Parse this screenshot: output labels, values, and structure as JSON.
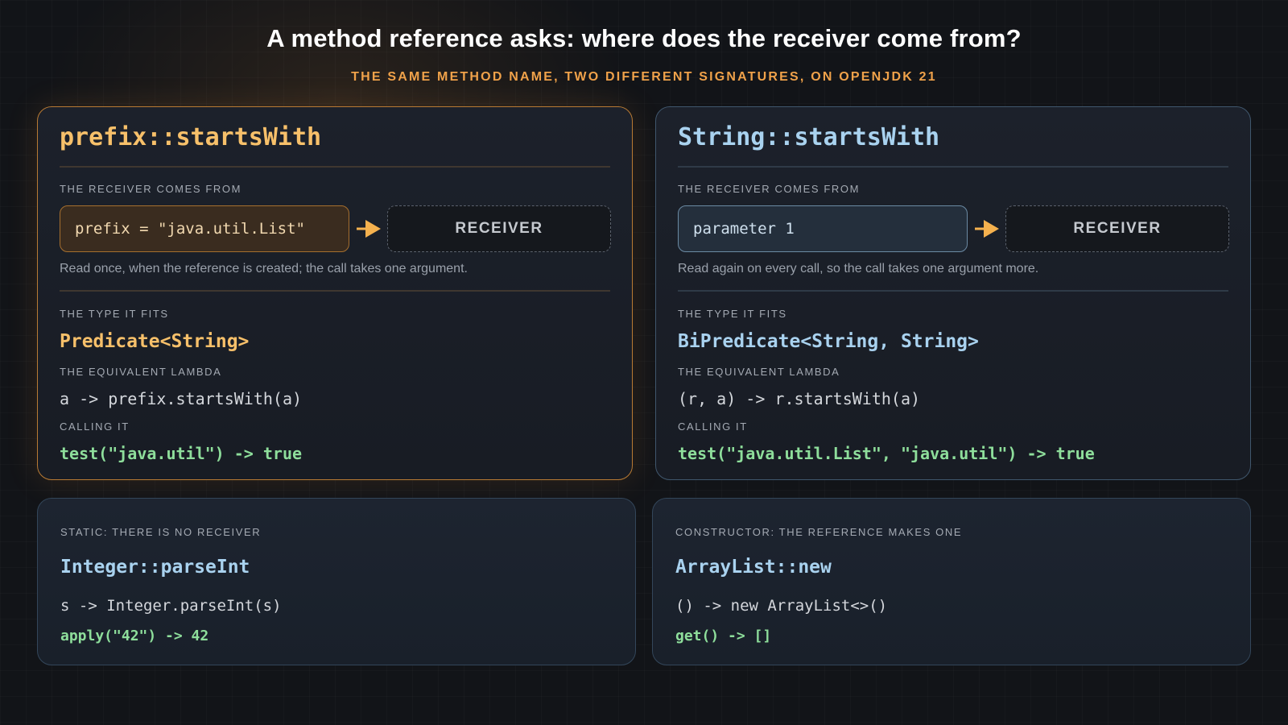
{
  "header": {
    "title": "A method reference asks: where does the receiver come from?",
    "subtitle": "THE SAME METHOD NAME, TWO DIFFERENT SIGNATURES, ON OPENJDK 21"
  },
  "bound_card": {
    "title": "prefix::startsWith",
    "receiver_label": "THE RECEIVER COMES FROM",
    "source": "prefix = \"java.util.List\"",
    "receiver": "RECEIVER",
    "note": "Read once, when the reference is created; the call takes one argument.",
    "type_label": "THE TYPE IT FITS",
    "type": "Predicate<String>",
    "lambda_label": "THE EQUIVALENT LAMBDA",
    "lambda": "a -> prefix.startsWith(a)",
    "call_label": "CALLING IT",
    "call": "test(\"java.util\") -> true"
  },
  "unbound_card": {
    "title": "String::startsWith",
    "receiver_label": "THE RECEIVER COMES FROM",
    "source": "parameter 1",
    "receiver": "RECEIVER",
    "note": "Read again on every call, so the call takes one argument more.",
    "type_label": "THE TYPE IT FITS",
    "type": "BiPredicate<String, String>",
    "lambda_label": "THE EQUIVALENT LAMBDA",
    "lambda": "(r, a) -> r.startsWith(a)",
    "call_label": "CALLING IT",
    "call": "test(\"java.util.List\", \"java.util\") -> true"
  },
  "static_card": {
    "label": "STATIC: THERE IS NO RECEIVER",
    "title": "Integer::parseInt",
    "lambda": "s -> Integer.parseInt(s)",
    "call": "apply(\"42\") -> 42"
  },
  "constructor_card": {
    "label": "CONSTRUCTOR: THE REFERENCE MAKES ONE",
    "title": "ArrayList::new",
    "lambda": "() -> new ArrayList<>()",
    "call": "get() -> []"
  },
  "colors": {
    "bound_accent": "#f7c06a",
    "unbound_accent": "#a9d2ef",
    "result_green": "#8ede9b",
    "subtitle_orange": "#f0a24a"
  }
}
